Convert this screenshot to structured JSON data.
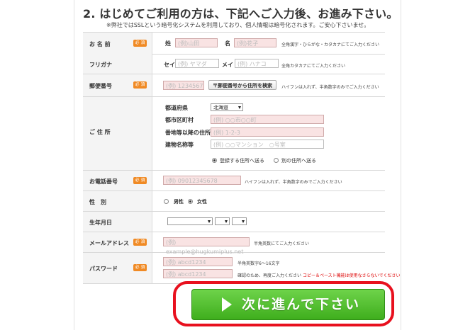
{
  "heading": "2. はじめてご利用の方は、下記へご入力後、お進み下さい。",
  "notice": "※弊社ではSSLという暗号化システムを利用しており、個人情報は暗号化されます。ご安心下さいませ。",
  "required_badge": "必 須",
  "name": {
    "label": "お 名 前",
    "sei_label": "姓",
    "sei_placeholder": "(例)山田",
    "mei_label": "名",
    "mei_placeholder": "(例)花子",
    "hint": "全角漢字・ひらがな・カタカナにてご入力ください"
  },
  "furigana": {
    "label": "フリガナ",
    "sei_label": "セイ",
    "sei_placeholder": "(例) ヤマダ",
    "mei_label": "メイ",
    "mei_placeholder": "(例) ハナコ",
    "hint": "全角カタカナにてご入力ください"
  },
  "postal": {
    "label": "郵便番号",
    "placeholder": "(例) 1234567",
    "search_button": "〒郵便番号から住所を検索",
    "hint": "ハイフンは入れず、半角数字のみでご入力ください"
  },
  "address": {
    "label": "ご 住 所",
    "pref_label": "都道府県",
    "pref_value": "北海道",
    "city_label": "都市区町村",
    "city_placeholder": "(例) ○○市○○町",
    "street_label": "番地等以降の住所",
    "street_placeholder": "(例) 1-2-3",
    "building_label": "建物名称等",
    "building_placeholder": "(例) ○○マンション　○号室",
    "send_registered": "登録する住所へ送る",
    "send_other": "別の住所へ送る"
  },
  "phone": {
    "label": "お電話番号",
    "placeholder": "(例) 09012345678",
    "hint": "ハイフンは入れず、半角数字のみでご入力ください"
  },
  "gender": {
    "label": "性　別",
    "male": "男性",
    "female": "女性"
  },
  "birthday": {
    "label": "生年月日"
  },
  "email": {
    "label": "メールアドレス",
    "placeholder": "(例) example@hugkumiplus.net",
    "hint": "半角英数にてご入力ください"
  },
  "password": {
    "label": "パスワード",
    "placeholder1": "(例) abcd1234",
    "placeholder2": "(例) abcd1234",
    "hint1": "半角英数字6～16文字",
    "hint2_a": "確認のため、再度ご入力ください",
    "hint2_b": "コピー＆ペースト機能は使用なさらないでください"
  },
  "cta": {
    "label": "次に進んで下さい",
    "highlight_color": "#e8101e",
    "button_color": "#4cbb25"
  },
  "colors": {
    "required_badge": "#f08a24",
    "input_fill": "#f9e3e3"
  }
}
